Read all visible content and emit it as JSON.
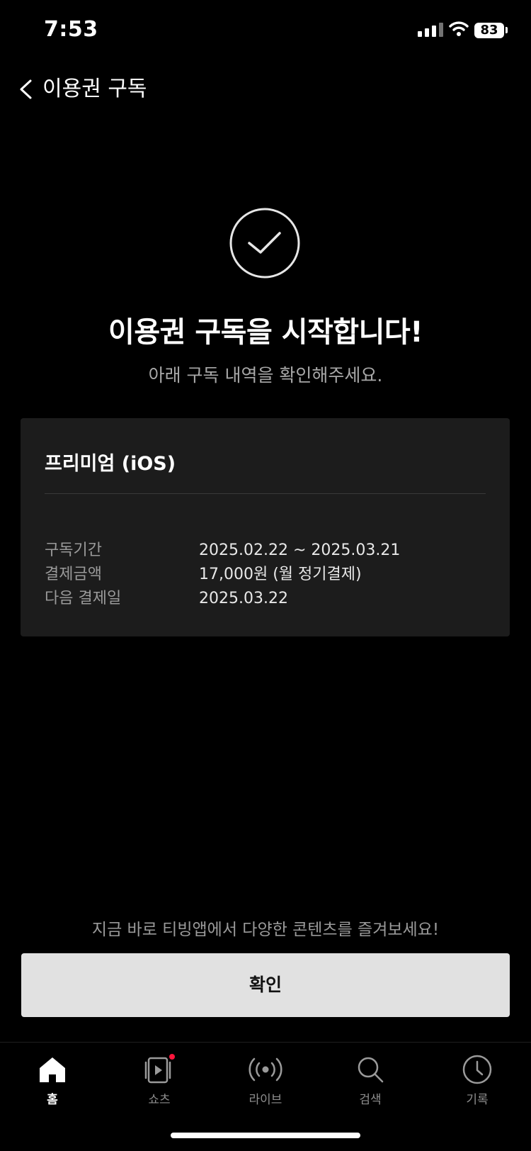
{
  "status_bar": {
    "time": "7:53",
    "battery": "83"
  },
  "header": {
    "back_icon": "chevron-left-icon",
    "title": "이용권 구독"
  },
  "hero": {
    "icon": "check-circle-icon",
    "title": "이용권 구독을 시작합니다!",
    "subtitle": "아래 구독 내역을 확인해주세요."
  },
  "card": {
    "plan_name": "프리미엄 (iOS)",
    "rows": [
      {
        "label": "구독기간",
        "value": "2025.02.22 ~ 2025.03.21"
      },
      {
        "label": "결제금액",
        "value": "17,000원 (월 정기결제)"
      },
      {
        "label": "다음 결제일",
        "value": "2025.03.22"
      }
    ]
  },
  "promo_text": "지금 바로 티빙앱에서 다양한 콘텐츠를 즐겨보세요!",
  "confirm_label": "확인",
  "tabbar": {
    "tabs": [
      {
        "label": "홈",
        "icon": "home-icon",
        "active": true
      },
      {
        "label": "쇼츠",
        "icon": "shorts-icon",
        "badge": true
      },
      {
        "label": "라이브",
        "icon": "live-icon"
      },
      {
        "label": "검색",
        "icon": "search-icon"
      },
      {
        "label": "기록",
        "icon": "history-icon"
      }
    ]
  },
  "colors": {
    "background": "#000000",
    "card": "#1c1c1c",
    "button": "#e1e1e1",
    "badge": "#ff153c"
  }
}
